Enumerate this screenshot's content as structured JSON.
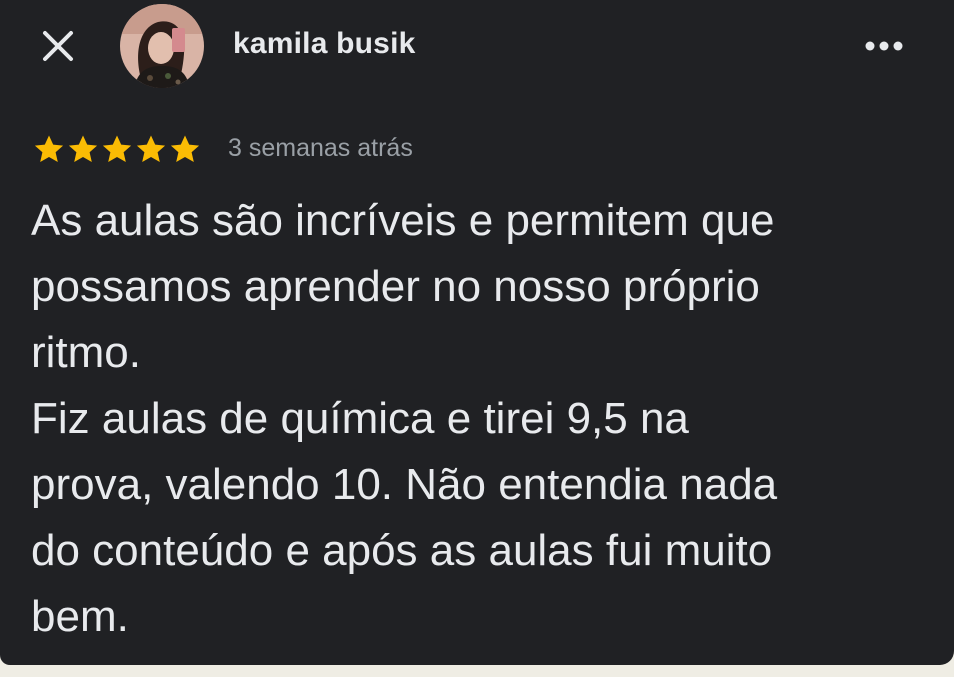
{
  "header": {
    "close_icon": "close-icon",
    "reviewer_name": "kamila busik",
    "more_icon": "more-horiz-icon"
  },
  "review": {
    "rating": 5,
    "rating_max": 5,
    "star_color": "#fbbc04",
    "date": "3 semanas atrás",
    "text_lines": [
      "As aulas são incríveis e permitem que",
      "possamos aprender no nosso próprio",
      "ritmo.",
      "Fiz aulas de química e tirei 9,5 na",
      "prova, valendo 10. Não entendia nada",
      "do conteúdo e após as aulas fui muito",
      "bem."
    ]
  },
  "colors": {
    "card_background": "#202124",
    "page_background": "#efede4",
    "text_primary": "#e8eaed",
    "text_secondary": "#9aa0a6"
  }
}
